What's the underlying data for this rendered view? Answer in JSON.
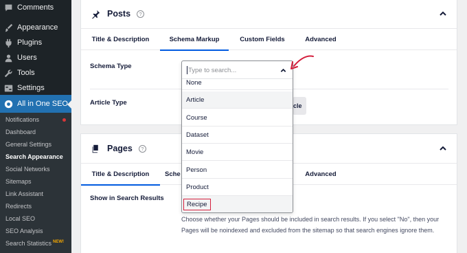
{
  "sidebar": {
    "menu": [
      {
        "label": "Comments",
        "icon": "comments-icon"
      },
      {
        "label": "Appearance",
        "icon": "paintbrush-icon"
      },
      {
        "label": "Plugins",
        "icon": "plugin-icon"
      },
      {
        "label": "Users",
        "icon": "users-icon"
      },
      {
        "label": "Tools",
        "icon": "wrench-icon"
      },
      {
        "label": "Settings",
        "icon": "settings-icon"
      },
      {
        "label": "All in One SEO",
        "icon": "aioseo-icon"
      }
    ],
    "submenu": [
      {
        "label": "Notifications"
      },
      {
        "label": "Dashboard"
      },
      {
        "label": "General Settings"
      },
      {
        "label": "Search Appearance"
      },
      {
        "label": "Social Networks"
      },
      {
        "label": "Sitemaps"
      },
      {
        "label": "Link Assistant"
      },
      {
        "label": "Redirects"
      },
      {
        "label": "Local SEO"
      },
      {
        "label": "SEO Analysis"
      },
      {
        "label": "Search Statistics"
      }
    ],
    "new_badge": "NEW!",
    "colors": {
      "bg": "#1d2327",
      "active": "#2271b1",
      "notification": "#d63638"
    }
  },
  "posts_card": {
    "title": "Posts",
    "help": "?",
    "tabs": [
      "Title & Description",
      "Schema Markup",
      "Custom Fields",
      "Advanced"
    ],
    "active_tab": "Schema Markup",
    "schema_type_label": "Schema Type",
    "article_type_label": "Article Type",
    "article_btn_partial": "cle"
  },
  "pages_card": {
    "title": "Pages",
    "help": "?",
    "tabs": [
      "Title & Description",
      "Sche",
      "Advanced"
    ],
    "active_tab": "Title & Description",
    "show_label": "Show in Search Results",
    "description": "Choose whether your Pages should be included in search results. If you select \"No\", then your Pages will be noindexed and excluded from the sitemap so that search engines ignore them."
  },
  "dropdown": {
    "placeholder": "Type to search...",
    "options": [
      "None",
      "Article",
      "Course",
      "Dataset",
      "Movie",
      "Person",
      "Product",
      "Recipe"
    ],
    "highlighted": [
      "Article",
      "Recipe"
    ],
    "boxed": "Recipe",
    "colors": {
      "box": "#d41e3c",
      "accent": "#005ae0"
    }
  }
}
